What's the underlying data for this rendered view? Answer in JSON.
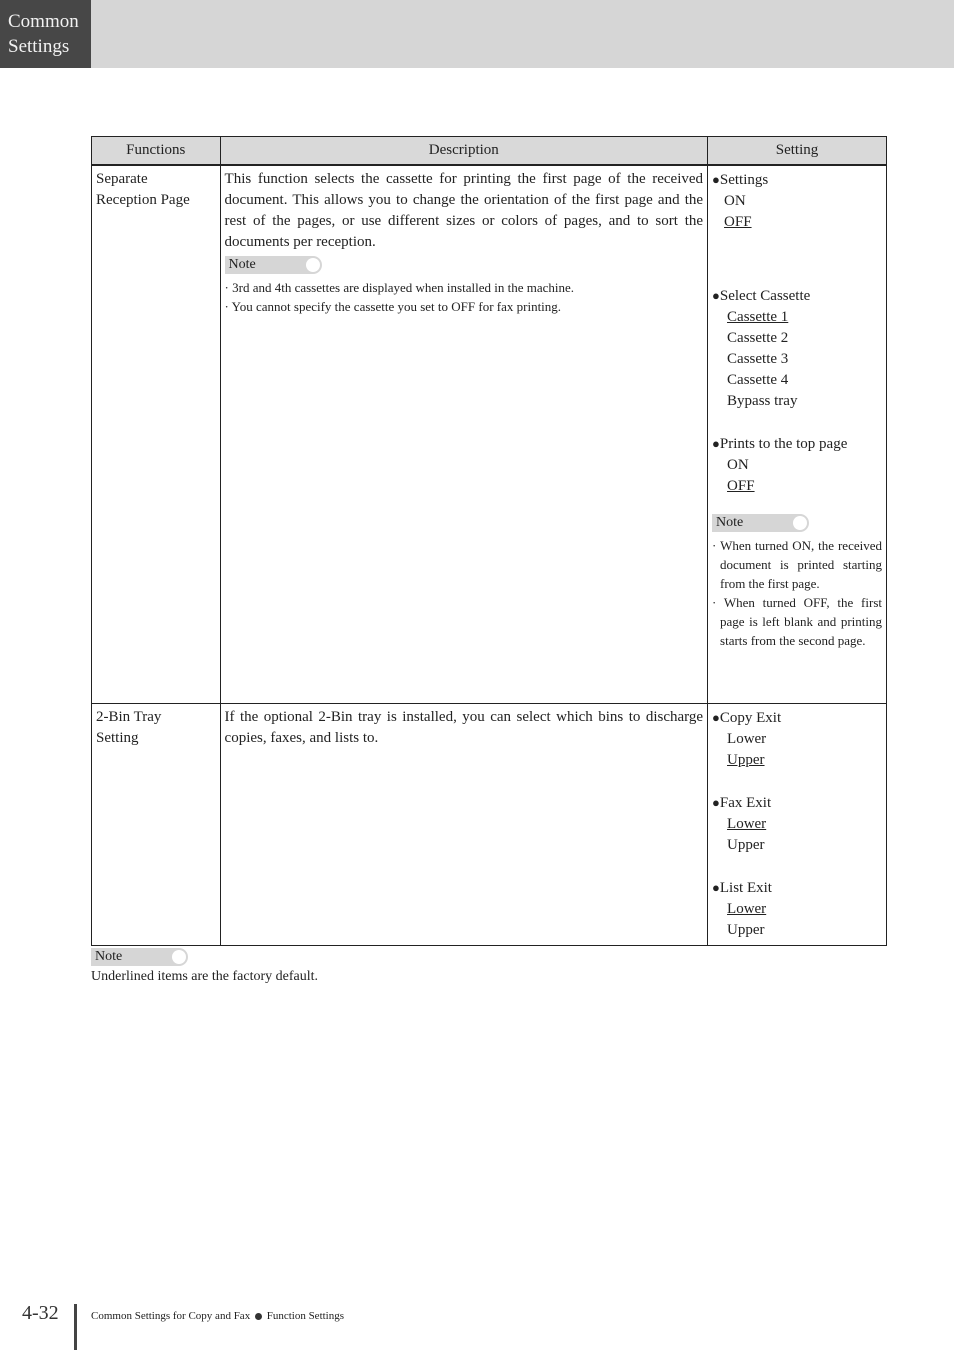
{
  "header": {
    "section_line1": "Common",
    "section_line2": "Settings"
  },
  "table": {
    "columns": [
      "Functions",
      "Description",
      "Setting"
    ],
    "rows": [
      {
        "function": [
          "Separate",
          "Reception Page"
        ],
        "description": "This function selects the cassette for printing the first page of the received document. This allows you to change the orientation of the first page and the rest of the pages, or use different sizes or colors of pages, and to sort the documents per reception.",
        "note_label": "Note",
        "notes": [
          "· 3rd and 4th cassettes are displayed when installed in the machine.",
          "· You cannot specify the cassette you set to OFF for fax printing."
        ],
        "settings": [
          {
            "title": "Settings",
            "options": [
              {
                "label": "ON",
                "default": false
              },
              {
                "label": "OFF",
                "default": true
              }
            ]
          },
          {
            "title": "Select Cassette",
            "options": [
              {
                "label": "Cassette 1",
                "default": true
              },
              {
                "label": "Cassette 2",
                "default": false
              },
              {
                "label": "Cassette 3",
                "default": false
              },
              {
                "label": "Cassette 4",
                "default": false
              },
              {
                "label": "Bypass tray",
                "default": false
              }
            ]
          },
          {
            "title": "Prints to the top page",
            "options": [
              {
                "label": "ON",
                "default": false
              },
              {
                "label": "OFF",
                "default": true
              }
            ]
          }
        ],
        "setting_note_label": "Note",
        "setting_notes": [
          "· When turned ON, the received document is printed starting from the first page.",
          "· When turned OFF, the first page is left blank and printing starts from the second page."
        ]
      },
      {
        "function": [
          "2-Bin Tray",
          "Setting"
        ],
        "description": "If the optional 2-Bin tray is installed, you can select which bins to discharge copies, faxes, and lists to.",
        "settings": [
          {
            "title": "Copy Exit",
            "options": [
              {
                "label": "Lower",
                "default": false
              },
              {
                "label": "Upper",
                "default": true
              }
            ]
          },
          {
            "title": "Fax Exit",
            "options": [
              {
                "label": "Lower",
                "default": true
              },
              {
                "label": "Upper",
                "default": false
              }
            ]
          },
          {
            "title": "List Exit",
            "options": [
              {
                "label": "Lower",
                "default": true
              },
              {
                "label": "Upper",
                "default": false
              }
            ]
          }
        ]
      }
    ]
  },
  "bottom_note": {
    "label": "Note",
    "text": "Underlined items are the factory default."
  },
  "footer": {
    "page_number": "4-32",
    "chapter": "Common Settings for Copy and Fax",
    "section": "Function Settings"
  }
}
